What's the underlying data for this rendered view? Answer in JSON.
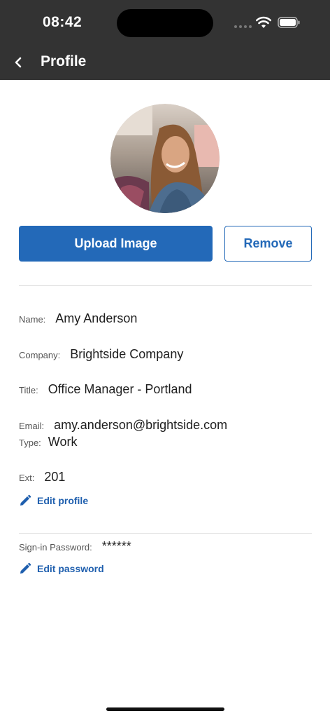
{
  "status_bar": {
    "time": "08:42"
  },
  "nav": {
    "title": "Profile"
  },
  "profile_photo": {
    "buttons": {
      "upload": "Upload Image",
      "remove": "Remove"
    }
  },
  "fields": {
    "name": {
      "label": "Name:",
      "value": "Amy Anderson"
    },
    "company": {
      "label": "Company:",
      "value": "Brightside Company"
    },
    "title": {
      "label": "Title:",
      "value": "Office Manager - Portland"
    },
    "email": {
      "label": "Email:",
      "value": "amy.anderson@brightside.com"
    },
    "type": {
      "label": "Type:",
      "value": "Work"
    },
    "ext": {
      "label": "Ext:",
      "value": "201"
    }
  },
  "edit_profile": {
    "label": "Edit profile",
    "icon": "pencil-icon"
  },
  "password": {
    "label": "Sign-in Password:",
    "value": "******"
  },
  "edit_password": {
    "label": "Edit password",
    "icon": "pencil-icon"
  },
  "colors": {
    "header": "#333333",
    "accent": "#2369b8",
    "link": "#1f5fae"
  }
}
